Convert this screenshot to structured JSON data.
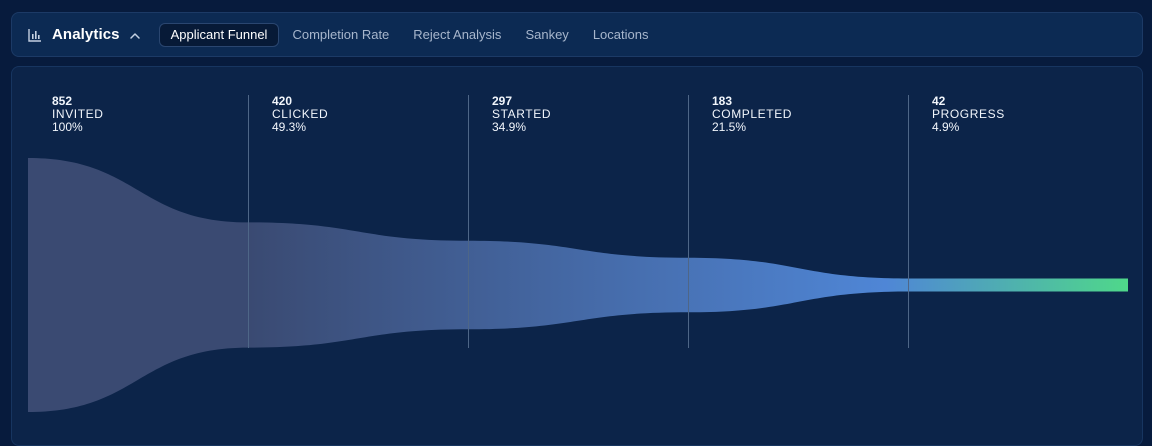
{
  "header": {
    "title": "Analytics",
    "tabs": [
      {
        "label": "Applicant Funnel",
        "active": true
      },
      {
        "label": "Completion Rate",
        "active": false
      },
      {
        "label": "Reject Analysis",
        "active": false
      },
      {
        "label": "Sankey",
        "active": false
      },
      {
        "label": "Locations",
        "active": false
      }
    ]
  },
  "funnel": {
    "stages": [
      {
        "count": "852",
        "label": "INVITED",
        "percent": "100%"
      },
      {
        "count": "420",
        "label": "CLICKED",
        "percent": "49.3%"
      },
      {
        "count": "297",
        "label": "STARTED",
        "percent": "34.9%"
      },
      {
        "count": "183",
        "label": "COMPLETED",
        "percent": "21.5%"
      },
      {
        "count": "42",
        "label": "PROGRESS",
        "percent": "4.9%"
      }
    ],
    "colors": {
      "start": "#3a4a72",
      "mid": "#4f86d6",
      "end": "#4fd88a"
    }
  }
}
